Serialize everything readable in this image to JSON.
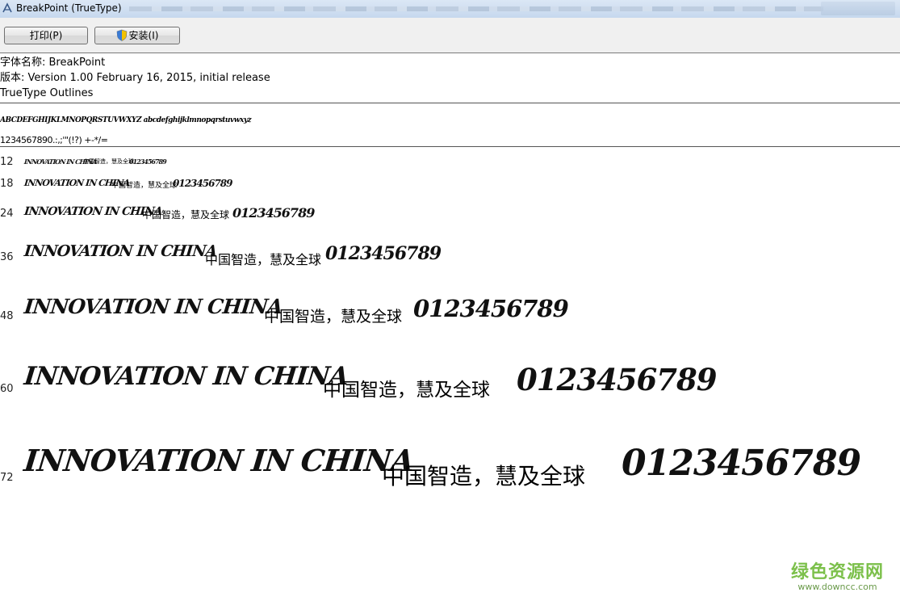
{
  "window": {
    "title": "BreakPoint (TrueType)"
  },
  "toolbar": {
    "print_label": "打印(P)",
    "install_label": "安装(I)"
  },
  "info": {
    "font_name": "字体名称: BreakPoint",
    "version": "版本: Version 1.00 February 16, 2015, initial release",
    "outline": "TrueType Outlines"
  },
  "charset": {
    "line1": "ABCDEFGHIJKLMNOPQRSTUVWXYZ abcdefghijklmnopqrstuvwxyz",
    "line2": "1234567890.:,;'\"(!?) +-*/="
  },
  "samples": [
    {
      "size": "12",
      "latin": "INNOVATION IN CHINA",
      "cjk": "中国智造，慧及全球",
      "digits": "0123456789"
    },
    {
      "size": "18",
      "latin": "INNOVATION IN CHINA",
      "cjk": "中国智造，慧及全球",
      "digits": "0123456789"
    },
    {
      "size": "24",
      "latin": "INNOVATION IN CHINA",
      "cjk": "中国智造，慧及全球",
      "digits": "0123456789"
    },
    {
      "size": "36",
      "latin": "INNOVATION IN CHINA",
      "cjk": "中国智造，慧及全球",
      "digits": "0123456789"
    },
    {
      "size": "48",
      "latin": "INNOVATION IN CHINA",
      "cjk": "中国智造，慧及全球",
      "digits": "0123456789"
    },
    {
      "size": "60",
      "latin": "INNOVATION IN CHINA",
      "cjk": "中国智造，慧及全球",
      "digits": "0123456789"
    },
    {
      "size": "72",
      "latin": "INNOVATION IN CHINA",
      "cjk": "中国智造，慧及全球",
      "digits": "0123456789"
    }
  ],
  "watermark": {
    "main": "绿色资源网",
    "url": "www.downcc.com"
  },
  "colors": {
    "titlebar": "#c6d8ee",
    "toolbar": "#f0f0f0",
    "watermark": "#7cc04b"
  }
}
